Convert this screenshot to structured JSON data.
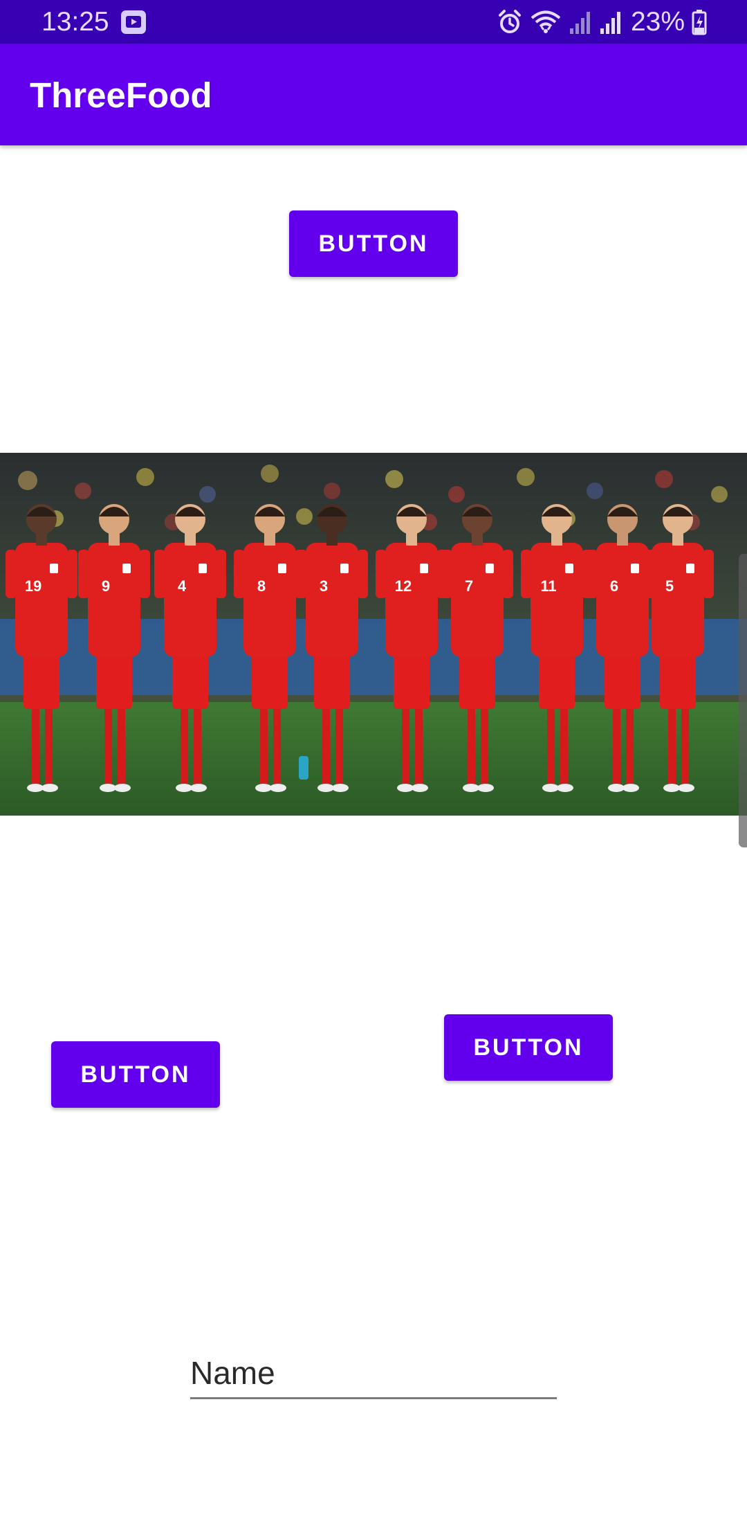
{
  "status_bar": {
    "time": "13:25",
    "battery": "23%",
    "icons": [
      "video-app-icon",
      "alarm-icon",
      "wifi-icon",
      "signal-icon",
      "signal-icon",
      "battery-charging-icon"
    ]
  },
  "app_bar": {
    "title": "ThreeFood"
  },
  "buttons": {
    "top_label": "BUTTON",
    "left_label": "BUTTON",
    "right_label": "BUTTON"
  },
  "image": {
    "jersey_numbers": [
      "19",
      "9",
      "4",
      "8",
      "3",
      "12",
      "7",
      "11",
      "6",
      "5"
    ]
  },
  "form": {
    "name_placeholder": "Name",
    "name_value": ""
  },
  "colors": {
    "status_bar": "#3700b3",
    "primary": "#6200ee",
    "background": "#ffffff"
  }
}
